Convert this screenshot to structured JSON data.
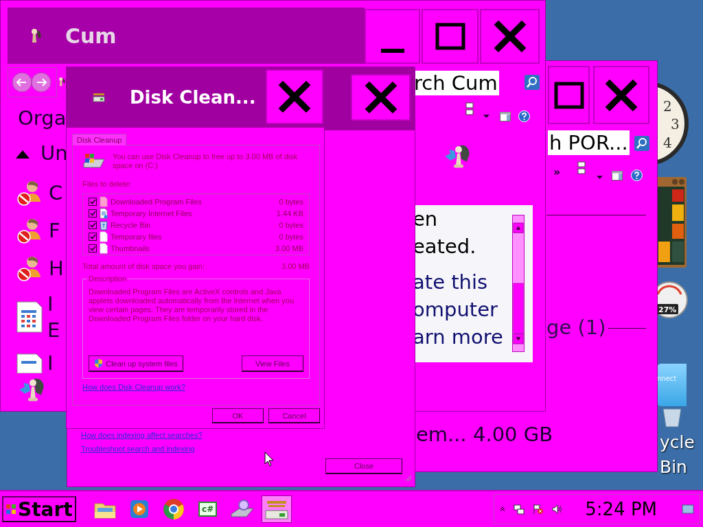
{
  "desktop": {
    "clock_numerals": [
      "2",
      "3",
      "4"
    ],
    "cpu_meter": "27%",
    "connect_tile": "nnect",
    "recycle_bin_label": [
      "ycle",
      "Bin"
    ]
  },
  "back_window": {
    "search_value": "h POR...",
    "overflow": "»",
    "section_heading": "ge (1)",
    "drive_row": "em... 4.00 GB"
  },
  "explorer_window": {
    "title": "Cum",
    "search_value": "rch Cum",
    "organize": "Orga",
    "group": "Un",
    "items": [
      {
        "kind": "user",
        "lines": [
          "C"
        ]
      },
      {
        "kind": "user",
        "lines": [
          "F"
        ]
      },
      {
        "kind": "user",
        "lines": [
          "H"
        ]
      },
      {
        "kind": "calendar",
        "lines": [
          "I",
          "E"
        ]
      },
      {
        "kind": "file",
        "lines": [
          "I"
        ]
      }
    ],
    "preview_lines": [
      {
        "kind": "text",
        "text": "en"
      },
      {
        "kind": "text",
        "text": "eated."
      },
      {
        "kind": "link",
        "text": "ate this"
      },
      {
        "kind": "link",
        "text": "omputer"
      },
      {
        "kind": "link",
        "text": "arn more"
      }
    ]
  },
  "indexing_window": {
    "links": [
      "How does indexing affect searches?",
      "Troubleshoot search and indexing"
    ],
    "close_button": "Close"
  },
  "disk_cleanup": {
    "title": "Disk Clean...",
    "tab": {
      "label": "Disk Cleanup",
      "selected": true
    },
    "intro": "You can use Disk Cleanup to free up to 3.00 MB of disk space on  (C:)",
    "files_label": "Files to delete:",
    "files": [
      {
        "kind": "program",
        "name": "Downloaded Program Files",
        "size": "0 bytes",
        "checked": true
      },
      {
        "kind": "internet",
        "name": "Temporary Internet Files",
        "size": "1.44 KB",
        "checked": true
      },
      {
        "kind": "recycle",
        "name": "Recycle Bin",
        "size": "0 bytes",
        "checked": true
      },
      {
        "kind": "blank",
        "name": "Temporary files",
        "size": "0 bytes",
        "checked": true
      },
      {
        "kind": "blank",
        "name": "Thumbnails",
        "size": "3.00 MB",
        "checked": true
      }
    ],
    "total_label": "Total amount of disk space you gain:",
    "total_value": "3.00 MB",
    "description_legend": "Description",
    "description": "Downloaded Program Files are ActiveX controls and Java applets downloaded automatically from the Internet when you view certain pages.  They are temporarily stored in the Downloaded Program Files folder on your hard disk.",
    "buttons": [
      "Clean up system files",
      "View Files"
    ],
    "help_link": "How does Disk Cleanup work?",
    "dialog_buttons": [
      "OK",
      "Cancel"
    ]
  },
  "taskbar": {
    "start": "Start",
    "apps": [
      {
        "kind": "explorer",
        "selected": false
      },
      {
        "kind": "media",
        "selected": false
      },
      {
        "kind": "browser",
        "selected": false
      },
      {
        "kind": "code",
        "label": "c#",
        "selected": false
      },
      {
        "kind": "search",
        "selected": false
      },
      {
        "kind": "cleanup",
        "selected": true
      }
    ],
    "clock": "5:24 PM"
  }
}
